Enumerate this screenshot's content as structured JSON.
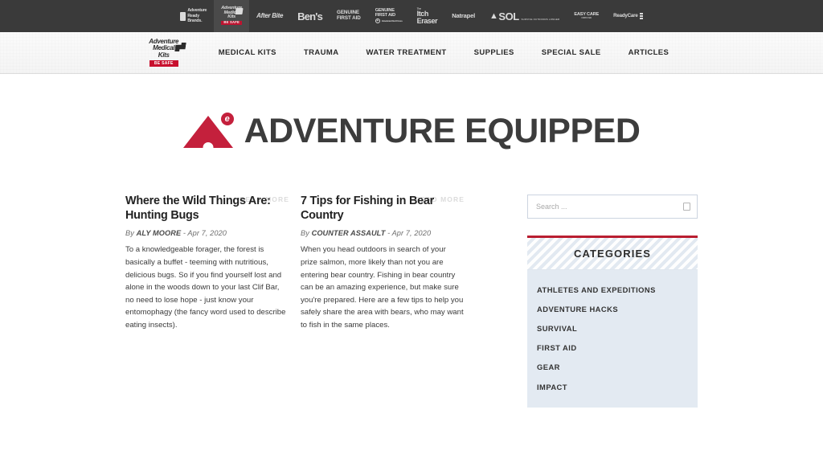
{
  "brandbar": {
    "brands": [
      {
        "id": "adventure-ready-brands",
        "line1": "Adventure",
        "line2": "Ready",
        "line3": "Brands.",
        "active": false
      },
      {
        "id": "adventure-medical-kits",
        "line1": "Adventure",
        "line2": "Medical",
        "line3": "Kits",
        "badge": "BE SAFE",
        "active": true
      },
      {
        "id": "after-bite",
        "label": "After Bite",
        "active": false
      },
      {
        "id": "bens",
        "label": "Ben's",
        "active": false
      },
      {
        "id": "genuine-first-aid",
        "line1": "GENUINE",
        "line2": "FIRST AID",
        "active": false
      },
      {
        "id": "genuine-first-aid-arc",
        "line1": "GENUINE",
        "line2": "FIRST AID",
        "line3": "American Red Cross",
        "active": false
      },
      {
        "id": "itch-eraser",
        "line1": "The",
        "line2": "Itch",
        "line3": "Eraser",
        "active": false
      },
      {
        "id": "natrapel",
        "label": "Natrapel",
        "active": false
      },
      {
        "id": "sol",
        "label": "SOL",
        "sub": "SURVIVE OUTDOORS LONGER",
        "active": false
      },
      {
        "id": "easy-care",
        "line1": "EASY CARE",
        "sub": "FIRST AID",
        "active": false
      },
      {
        "id": "ready-care",
        "label": "ReadyCare",
        "active": false
      }
    ]
  },
  "mainnav": {
    "logo": {
      "line1": "Adventure",
      "line2": "Medical",
      "line3": "Kits",
      "badge": "BE SAFE"
    },
    "items": [
      {
        "label": "MEDICAL KITS"
      },
      {
        "label": "TRAUMA"
      },
      {
        "label": "WATER TREATMENT"
      },
      {
        "label": "SUPPLIES"
      },
      {
        "label": "SPECIAL SALE"
      },
      {
        "label": "ARTICLES"
      }
    ]
  },
  "hero": {
    "mark_letter": "e",
    "title": "ADVENTURE EQUIPPED"
  },
  "articles": [
    {
      "title": "Where the Wild Things Are: Hunting Bugs",
      "read_more": "READ MORE",
      "by_prefix": "By",
      "author": "ALY MOORE",
      "separator": "-",
      "date": "Apr 7, 2020",
      "excerpt": "To a knowledgeable forager, the forest is basically a buffet - teeming with nutritious, delicious bugs. So if you find yourself lost and alone in the woods down to your last Clif Bar, no need to lose hope - just know your entomophagy (the fancy word used to describe eating insects)."
    },
    {
      "title": "7 Tips for Fishing in Bear Country",
      "read_more": "READ MORE",
      "by_prefix": "By",
      "author": "COUNTER ASSAULT",
      "separator": "-",
      "date": "Apr 7, 2020",
      "excerpt": "When you head outdoors in search of your prize salmon, more likely than not you are entering bear country. Fishing in bear country can be an amazing experience, but make sure you're prepared. Here are a few tips to help you safely share the area with bears, who may want to fish in the same places."
    }
  ],
  "sidebar": {
    "search": {
      "placeholder": "Search ...",
      "value": ""
    },
    "categories": {
      "title": "CATEGORIES",
      "items": [
        {
          "label": "ATHLETES AND EXPEDITIONS"
        },
        {
          "label": "ADVENTURE HACKS"
        },
        {
          "label": "SURVIVAL"
        },
        {
          "label": "FIRST AID"
        },
        {
          "label": "GEAR"
        },
        {
          "label": "IMPACT"
        }
      ]
    }
  },
  "colors": {
    "brand_red": "#c4203c",
    "accent_red": "#b91e31",
    "topbar_dark": "#3a3a3a",
    "sidebar_bg": "#e3eaf2",
    "heading_dark": "#3c3c3c"
  }
}
